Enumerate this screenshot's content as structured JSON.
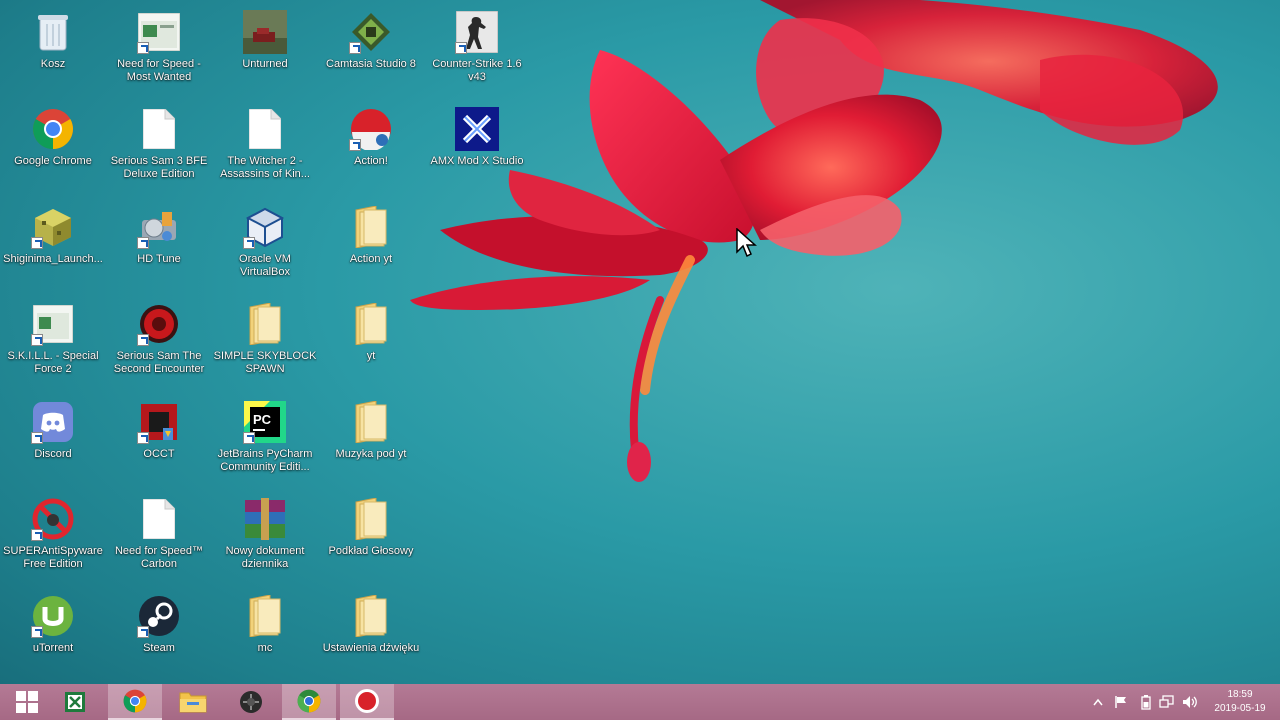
{
  "desktop": {
    "icons": [
      {
        "label": "Kosz",
        "icon": "recycle-bin-icon"
      },
      {
        "label": "Need for Speed - Most Wanted",
        "icon": "nfs-most-wanted-icon"
      },
      {
        "label": "Unturned",
        "icon": "unturned-icon"
      },
      {
        "label": "Camtasia Studio 8",
        "icon": "camtasia-icon"
      },
      {
        "label": "Counter-Strike 1.6 v43",
        "icon": "counter-strike-icon"
      },
      {
        "label": "Google Chrome",
        "icon": "chrome-icon"
      },
      {
        "label": "Serious Sam 3 BFE Deluxe Edition",
        "icon": "document-icon"
      },
      {
        "label": "The Witcher 2 - Assassins of Kin...",
        "icon": "document-icon"
      },
      {
        "label": "Action!",
        "icon": "action-icon"
      },
      {
        "label": "AMX Mod X Studio",
        "icon": "amx-mod-icon"
      },
      {
        "label": "Shiginima_Launch...",
        "icon": "minecraft-block-icon"
      },
      {
        "label": "HD Tune",
        "icon": "hd-tune-icon"
      },
      {
        "label": "Oracle VM VirtualBox",
        "icon": "virtualbox-icon"
      },
      {
        "label": "Action yt",
        "icon": "folder-icon"
      },
      {
        "label": "S.K.I.L.L. - Special Force 2",
        "icon": "skill-icon"
      },
      {
        "label": "Serious Sam The Second Encounter",
        "icon": "serious-sam-icon"
      },
      {
        "label": "SIMPLE SKYBLOCK SPAWN",
        "icon": "folder-icon"
      },
      {
        "label": "yt",
        "icon": "folder-icon"
      },
      {
        "label": "Discord",
        "icon": "discord-icon"
      },
      {
        "label": "OCCT",
        "icon": "occt-icon"
      },
      {
        "label": "JetBrains PyCharm Community Editi...",
        "icon": "pycharm-icon"
      },
      {
        "label": "Muzyka pod yt",
        "icon": "folder-icon"
      },
      {
        "label": "SUPERAntiSpyware Free Edition",
        "icon": "superantispyware-icon"
      },
      {
        "label": "Need for Speed™ Carbon",
        "icon": "document-icon"
      },
      {
        "label": "Nowy dokument dziennika",
        "icon": "winrar-icon"
      },
      {
        "label": "Podkład Głosowy",
        "icon": "folder-icon"
      },
      {
        "label": "uTorrent",
        "icon": "utorrent-icon"
      },
      {
        "label": "Steam",
        "icon": "steam-icon"
      },
      {
        "label": "mc",
        "icon": "folder-icon"
      },
      {
        "label": "Ustawienia dźwięku",
        "icon": "folder-icon"
      }
    ]
  },
  "taskbar": {
    "buttons": [
      {
        "icon": "windows-start-icon",
        "active": false
      },
      {
        "icon": "excel-icon",
        "active": false
      },
      {
        "icon": "chrome-icon",
        "active": true
      },
      {
        "icon": "file-explorer-icon",
        "active": false
      },
      {
        "icon": "app-dark-icon",
        "active": false
      },
      {
        "icon": "chrome-canary-icon",
        "active": true
      },
      {
        "icon": "record-icon",
        "active": true
      }
    ],
    "tray": {
      "icons": [
        "chevron-up-icon",
        "flag-icon",
        "battery-icon",
        "network-icon",
        "volume-icon"
      ],
      "time": "18:59",
      "date": "2019-05-19"
    }
  },
  "colors": {
    "taskbar": "#a86c88",
    "wallpaper_teal": "#2a9aa6",
    "flower_red": "#d61a2c"
  }
}
